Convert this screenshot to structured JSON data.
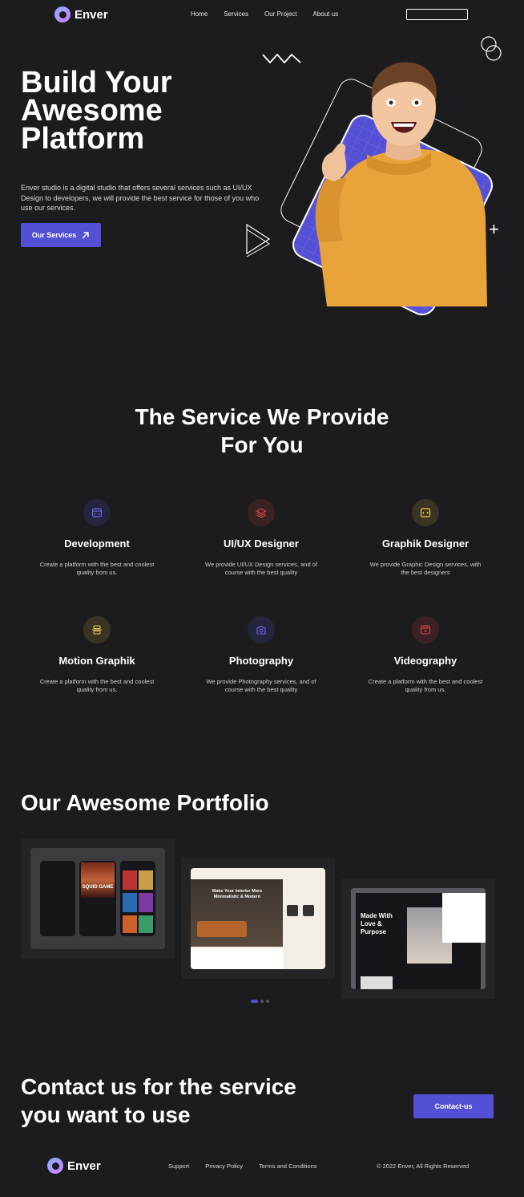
{
  "brand": {
    "name": "Enver",
    "logo_icon": "enver-logo-icon"
  },
  "nav": {
    "links": [
      "Home",
      "Services",
      "Our Project",
      "About us"
    ],
    "button_label": ""
  },
  "hero": {
    "title_lines": [
      "Build Your",
      "Awesome",
      "Platform"
    ],
    "description": "Enver studio is a digital studio that offers several services such as UI/UX Design to developers, we will provide the best service for those of you who use our services.",
    "cta_label": "Our Services",
    "cta_icon": "arrow-up-right-icon"
  },
  "services": {
    "title_lines": [
      "The Service We Provide",
      "For You"
    ],
    "items": [
      {
        "name": "Development",
        "desc": "Create a platform with the best and coolest quality from us.",
        "icon": "browser-icon",
        "color": "#5450d6"
      },
      {
        "name": "UI/UX Designer",
        "desc": "We provide UI/UX Design services, and of course with the best quality",
        "icon": "layers-icon",
        "color": "#e0444a"
      },
      {
        "name": "Graphik Designer",
        "desc": "We provide Graphic Design services, with the best designers",
        "icon": "code-window-icon",
        "color": "#f2c94c"
      },
      {
        "name": "Motion Graphik",
        "desc": "Create a platform with the best and coolest quality from us.",
        "icon": "motion-icon",
        "color": "#f2c94c"
      },
      {
        "name": "Photography",
        "desc": "We provide Photography services, and of course with the best quality",
        "icon": "camera-icon",
        "color": "#5450d6"
      },
      {
        "name": "Videography",
        "desc": "Create a platform with the best and coolest quality from us.",
        "icon": "video-icon",
        "color": "#e0444a"
      }
    ]
  },
  "portfolio": {
    "title": "Our Awesome Portfolio",
    "items": [
      {
        "label": "SQUID GAME",
        "kind": "mobile-app"
      },
      {
        "label": "Make Your Interior More Minimalistic & Modern",
        "kind": "website"
      },
      {
        "label": "Made With Love & Purpose",
        "kind": "website"
      }
    ],
    "pages": 3,
    "active_page": 1
  },
  "contact": {
    "title_lines": [
      "Contact us for the service",
      "you want to use"
    ],
    "button_label": "Contact-us"
  },
  "footer": {
    "links": [
      "Support",
      "Privacy Policy",
      "Terms and Conditions"
    ],
    "copyright": "© 2022 Enver, All Rights Reserved"
  },
  "colors": {
    "background": "#1c1c1e",
    "accent": "#5450d6",
    "hero_shirt": "#e8a33a"
  }
}
